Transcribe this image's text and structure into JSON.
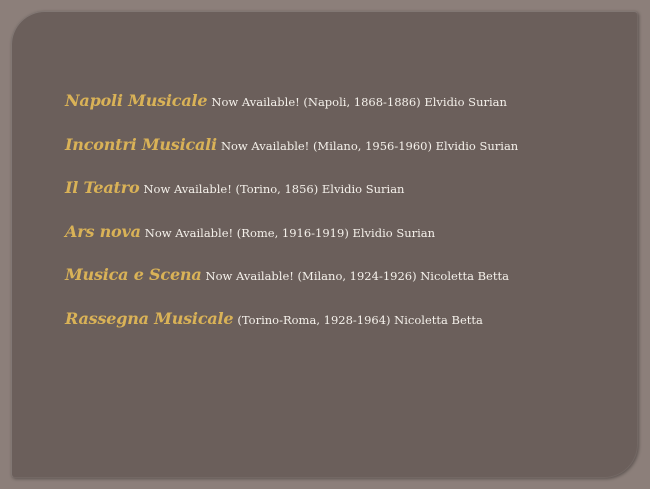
{
  "colors": {
    "background": "#8c7f7a",
    "panel": "#6b5f5b",
    "title_accent": "#d9b257",
    "body_text": "#f4f0ea"
  },
  "entries": [
    {
      "title": "Napoli Musicale",
      "detail": "Now Available! (Napoli, 1868-1886)  Elvidio Surian"
    },
    {
      "title": "Incontri Musicali",
      "detail": "Now Available! (Milano, 1956-1960)  Elvidio Surian"
    },
    {
      "title": "Il Teatro",
      "detail": "Now Available! (Torino, 1856) Elvidio Surian"
    },
    {
      "title": "Ars nova",
      "detail": "Now Available! (Rome, 1916-1919) Elvidio Surian"
    },
    {
      "title": "Musica e Scena",
      "detail": "Now Available! (Milano, 1924-1926)  Nicoletta Betta"
    },
    {
      "title": "Rassegna Musicale",
      "detail": "(Torino-Roma,  1928-1964)  Nicoletta Betta"
    }
  ]
}
